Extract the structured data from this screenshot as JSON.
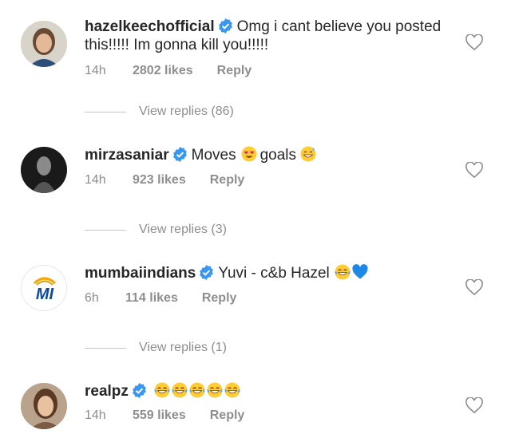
{
  "colors": {
    "verified": "#3897f0",
    "muted": "#8e8e8e",
    "text": "#262626"
  },
  "comments": [
    {
      "username": "hazelkeechofficial",
      "text": "Omg i cant believe you posted this!!!!! Im gonna kill you!!!!!",
      "time": "14h",
      "likes": "2802 likes",
      "reply": "Reply",
      "view_replies": "View replies (86)",
      "emoji": []
    },
    {
      "username": "mirzasaniar",
      "text_before": "Moves",
      "text_after": "goals",
      "time": "14h",
      "likes": "923 likes",
      "reply": "Reply",
      "view_replies": "View replies (3)",
      "emoji": [
        "heart-eyes-emoji",
        "grin-sweat-emoji"
      ]
    },
    {
      "username": "mumbaiindians",
      "text": "Yuvi - c&b Hazel",
      "time": "6h",
      "likes": "114 likes",
      "reply": "Reply",
      "view_replies": "View replies (1)",
      "emoji": [
        "tears-of-joy-emoji",
        "blue-heart-emoji"
      ]
    },
    {
      "username": "realpz",
      "text": "",
      "time": "14h",
      "likes": "559 likes",
      "reply": "Reply",
      "emoji": [
        "tears-of-joy-emoji",
        "tears-of-joy-emoji",
        "tears-of-joy-emoji",
        "tears-of-joy-emoji",
        "tears-of-joy-emoji"
      ]
    }
  ]
}
